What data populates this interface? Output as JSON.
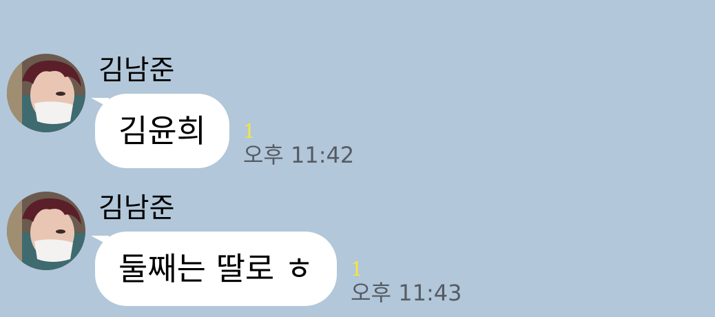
{
  "colors": {
    "background": "#b2c7d9",
    "bubble": "#ffffff",
    "unread": "#f5e742",
    "time": "#555b63"
  },
  "messages": [
    {
      "sender": "김남준",
      "text": "김윤희",
      "unread": "1",
      "time": "오후 11:42",
      "avatar_icon": "profile-photo"
    },
    {
      "sender": "김남준",
      "text": "둘째는 딸로 ㅎ",
      "unread": "1",
      "time": "오후 11:43",
      "avatar_icon": "profile-photo"
    }
  ]
}
